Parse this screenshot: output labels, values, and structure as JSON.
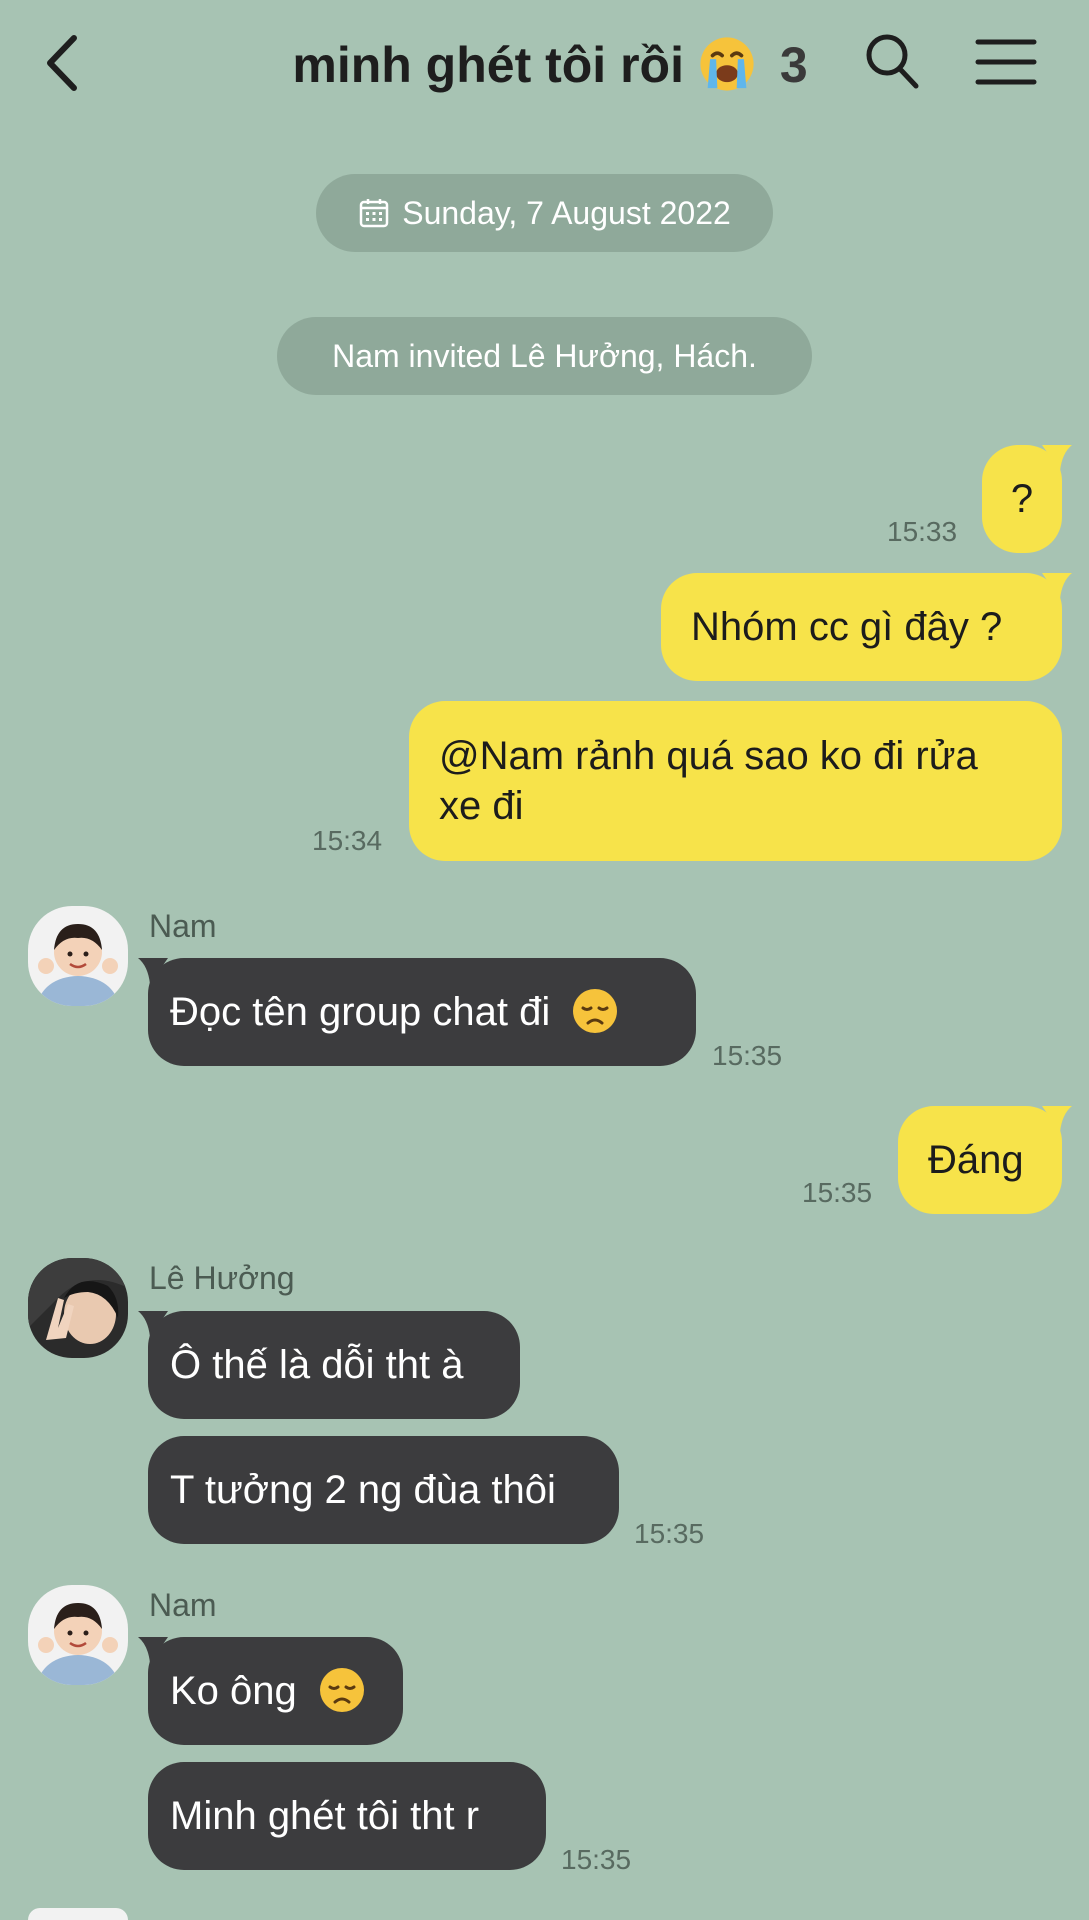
{
  "header": {
    "title": "minh ghét tôi rồi",
    "member_count": "3"
  },
  "date_divider": "Sunday, 7 August 2022",
  "system_message": "Nam invited Lê Hưởng, Hách.",
  "messages": [
    {
      "text": "?",
      "time": "15:33"
    },
    {
      "text": "Nhóm cc gì đây ?"
    },
    {
      "line1": "@Nam rảnh quá sao ko đi rửa",
      "line2": "xe đi",
      "time": "15:34"
    },
    {
      "sender": "Nam",
      "text": "Đọc tên group chat đi",
      "time": "15:35"
    },
    {
      "text": "Đáng",
      "time": "15:35"
    },
    {
      "sender": "Lê Hưởng",
      "text": "Ô thế là dỗi tht à"
    },
    {
      "text": "T tưởng 2 ng đùa thôi",
      "time": "15:35"
    },
    {
      "sender": "Nam",
      "text": "Ko ông"
    },
    {
      "text": "Minh ghét tôi tht r",
      "time": "15:35"
    }
  ],
  "colors": {
    "background": "#a7c3b3",
    "my_bubble": "#f7e34a",
    "their_bubble": "#3c3c3e"
  },
  "icons": {
    "back": "chevron-left-icon",
    "search": "search-icon",
    "menu": "hamburger-menu-icon",
    "calendar": "calendar-icon",
    "title_emoji": "loudly-crying-face-emoji",
    "sad_emoji": "disappointed-face-emoji"
  }
}
